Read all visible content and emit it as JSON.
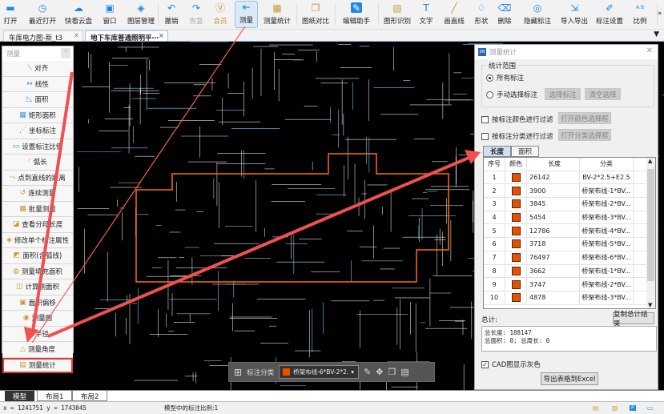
{
  "toolbar": {
    "items": [
      {
        "label": "打开",
        "icon": "folder-icon"
      },
      {
        "label": "最近打开",
        "icon": "clock-icon"
      },
      {
        "label": "快看云盘",
        "icon": "cloud-icon"
      },
      {
        "label": "窗口",
        "icon": "window-icon"
      },
      {
        "label": "图层管理",
        "icon": "layers-icon"
      },
      {
        "label": "撤销",
        "icon": "undo-icon"
      },
      {
        "label": "恢复",
        "icon": "redo-icon"
      },
      {
        "label": "会员",
        "icon": "vip-icon"
      },
      {
        "label": "测量",
        "icon": "ruler-icon"
      },
      {
        "label": "测量统计",
        "icon": "measure-stats-icon"
      },
      {
        "label": "图纸对比",
        "icon": "compare-icon"
      },
      {
        "label": "编辑助手",
        "icon": "edit-assistant-icon"
      },
      {
        "label": "图形识别",
        "icon": "shape-recognize-icon"
      },
      {
        "label": "文字",
        "icon": "text-icon"
      },
      {
        "label": "画直线",
        "icon": "line-icon"
      },
      {
        "label": "形状",
        "icon": "shapes-icon"
      },
      {
        "label": "删除",
        "icon": "eraser-icon"
      },
      {
        "label": "隐藏标注",
        "icon": "eye-hide-icon"
      },
      {
        "label": "导入导出",
        "icon": "import-export-icon"
      },
      {
        "label": "标注设置",
        "icon": "annotation-settings-icon"
      },
      {
        "label": "比例",
        "icon": "scale-icon"
      }
    ],
    "more": "»"
  },
  "doc_tabs": [
    {
      "label": "车库电力图-新_t3",
      "close": "×"
    },
    {
      "label": "地下车库普通照明平⋯",
      "close": "×"
    }
  ],
  "measure_panel": {
    "title": "测量",
    "close": "×",
    "items": [
      "对齐",
      "线性",
      "面积",
      "矩形面积",
      "坐标标注",
      "设置标注比例",
      "弧长",
      "点到直线的距离",
      "连续测量",
      "批量测量",
      "查看分段长度",
      "修改单个标注属性",
      "面积(含弧线)",
      "测量填充面积",
      "计算侧面积",
      "面积偏移",
      "测量圆",
      "半径",
      "测量角度",
      "测量统计"
    ]
  },
  "dialog": {
    "title": "测量统计",
    "close": "✕",
    "scope_label": "统计范围",
    "radio_all": "所有标注",
    "radio_manual": "手动选择标注",
    "btn_select": "选择标注",
    "btn_clear": "清空选择",
    "filter_color": "按标注颜色进行过滤",
    "btn_color": "打开颜色选择框",
    "filter_category": "按标注分类进行过滤",
    "btn_category": "打开分类选择框",
    "tabs": [
      "长度",
      "面积"
    ],
    "columns": [
      "序号",
      "颜色",
      "长度",
      "分类"
    ],
    "rows": [
      [
        "1",
        "#e65100",
        "26142",
        "BV-2*2.5+E2.5"
      ],
      [
        "2",
        "#e65100",
        "3900",
        "桥架布线-1*BV..."
      ],
      [
        "3",
        "#e65100",
        "3845",
        "桥架布线-2*BV..."
      ],
      [
        "4",
        "#e65100",
        "5454",
        "桥架布线-3*BV..."
      ],
      [
        "5",
        "#e65100",
        "12786",
        "桥架布线-4*BV..."
      ],
      [
        "6",
        "#e65100",
        "3718",
        "桥架布线-5*BV..."
      ],
      [
        "7",
        "#e65100",
        "76497",
        "桥架布线-6*BV..."
      ],
      [
        "8",
        "#e65100",
        "3662",
        "桥架布线-1*BV..."
      ],
      [
        "9",
        "#e65100",
        "3747",
        "桥架布线-2*BV..."
      ],
      [
        "10",
        "#e65100",
        "4878",
        "桥架布线-3*BV..."
      ]
    ],
    "total_label": "总计:",
    "btn_copy": "复制总计结果",
    "total_line1": "总长度: 188147",
    "total_line2": "总面积: 0; 总周长: 0",
    "gray_label": "CAD图显示灰色",
    "gray_checked": true,
    "btn_export": "导出表格到Excel"
  },
  "float_bar": {
    "label": "标注分类",
    "selected": "桥架布线-6*BV-2*2.",
    "selected_color": "#e65100"
  },
  "layout_tabs": [
    "模型",
    "布局1",
    "布局2"
  ],
  "status": {
    "coords": "x = 1241751  y = 1743045",
    "scale": "模型中的标注比例:1"
  }
}
